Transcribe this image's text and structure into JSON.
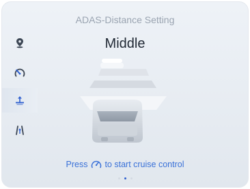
{
  "header": {
    "title": "ADAS-Distance Setting",
    "value": "Middle"
  },
  "sidebar": {
    "items": [
      {
        "icon": "location-pin-icon",
        "active": false
      },
      {
        "icon": "steering-speed-icon",
        "active": false
      },
      {
        "icon": "distance-setting-icon",
        "active": true
      },
      {
        "icon": "lane-keep-icon",
        "active": false
      }
    ]
  },
  "hint": {
    "before": "Press",
    "icon": "cruise-control-icon",
    "after": "to start cruise control"
  },
  "pager": {
    "count": 3,
    "active_index": 1
  },
  "colors": {
    "accent": "#2e5fcf",
    "title": "#9aa4b1",
    "value": "#1f2733",
    "hint": "#3a71d8",
    "background": "#e7ecf2"
  }
}
